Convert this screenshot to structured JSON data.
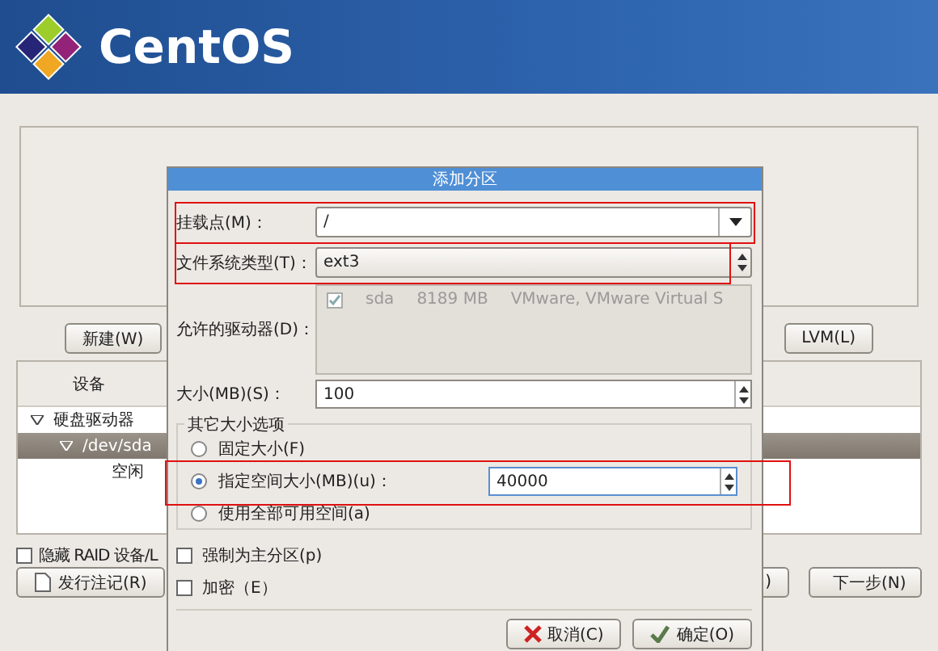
{
  "header": {
    "logo_text": "CentOS"
  },
  "main": {
    "new_button": "新建(W)",
    "lvm_button": "LVM(L)",
    "table": {
      "columns": [
        "设备"
      ],
      "tree": [
        {
          "label": "硬盘驱动器",
          "expanded": true,
          "selected": false,
          "children": [
            {
              "label": "/dev/sda",
              "expanded": true,
              "selected": true,
              "children": [
                {
                  "label": "空闲",
                  "selected": false
                }
              ]
            }
          ]
        }
      ]
    },
    "hide_raid": {
      "label": "隐藏 RAID 设备/L",
      "checked": false
    },
    "release_notes_button": "发行注记(R)",
    "back_button": ")",
    "next_button": "下一步(N)"
  },
  "dialog": {
    "title": "添加分区",
    "mount_point": {
      "label": "挂载点(M)：",
      "value": "/",
      "highlighted": true
    },
    "fs_type": {
      "label": "文件系统类型(T)：",
      "value": "ext3",
      "highlighted": true
    },
    "drives": {
      "label": "允许的驱动器(D)：",
      "disabled": true,
      "items": [
        {
          "checked": true,
          "name": "sda",
          "size": "8189 MB",
          "model": "VMware, VMware Virtual S"
        }
      ]
    },
    "size": {
      "label": "大小(MB)(S)：",
      "value": "100"
    },
    "size_options": {
      "title": "其它大小选项",
      "options": [
        {
          "label": "固定大小(F)",
          "selected": false
        },
        {
          "label": "指定空间大小(MB)(u)：",
          "selected": true,
          "value": "40000",
          "highlighted": true
        },
        {
          "label": "使用全部可用空间(a)",
          "selected": false
        }
      ]
    },
    "checkboxes": [
      {
        "label": "强制为主分区(p)",
        "checked": false
      },
      {
        "label": "加密（E）",
        "checked": false
      }
    ],
    "buttons": [
      {
        "kind": "cancel",
        "label": "取消(C)"
      },
      {
        "kind": "ok",
        "label": "确定(O)"
      }
    ]
  }
}
